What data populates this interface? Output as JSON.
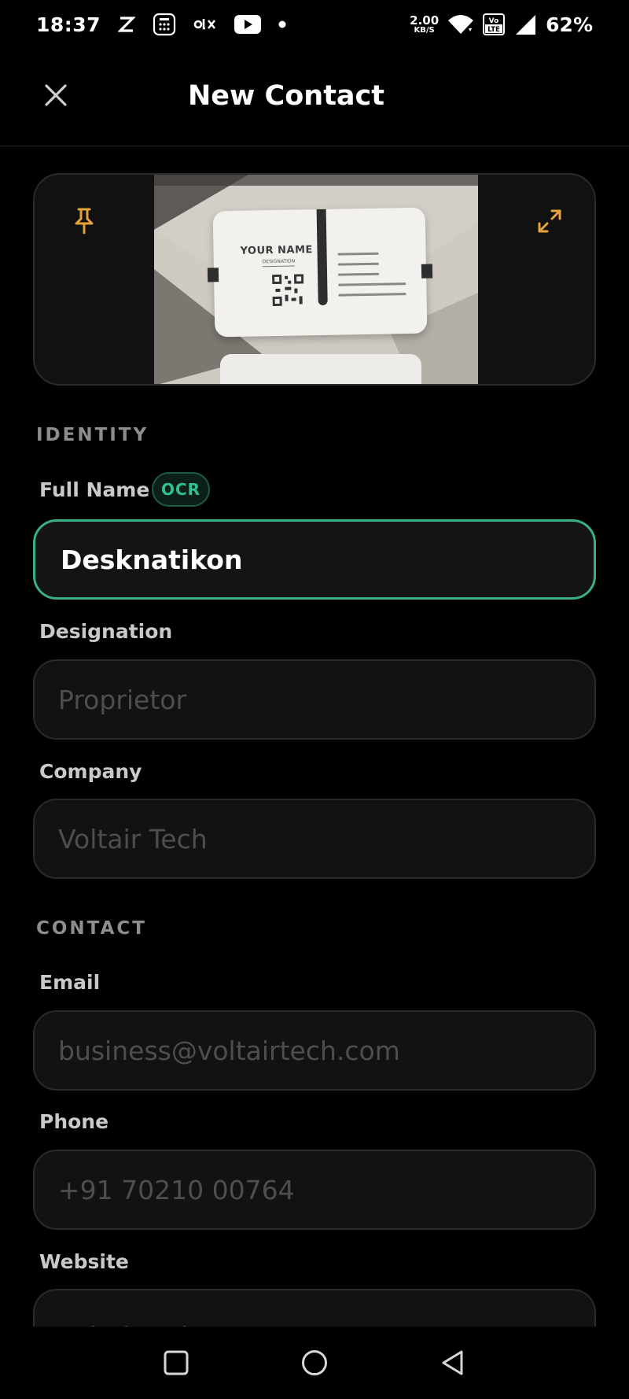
{
  "status_bar": {
    "time": "18:37",
    "network_speed_value": "2.00",
    "network_speed_unit": "KB/S",
    "battery": "62%",
    "icons": [
      "z-app-icon",
      "calculator-icon",
      "olx-icon",
      "youtube-icon",
      "dot-icon",
      "wifi-icon",
      "volte-icon",
      "signal-icon"
    ]
  },
  "header": {
    "title": "New Contact",
    "close_icon": "close-icon"
  },
  "card_preview": {
    "pin_icon": "pin-icon",
    "expand_icon": "expand-icon",
    "card_name_text": "YOUR NAME",
    "card_designation_text": "DESIGNATION",
    "accent_color": "#e8a23a"
  },
  "sections": {
    "identity": "IDENTITY",
    "contact": "CONTACT"
  },
  "fields": {
    "full_name": {
      "label": "Full Name",
      "badge": "OCR",
      "value": "Desknatikon"
    },
    "designation": {
      "label": "Designation",
      "placeholder": "Proprietor"
    },
    "company": {
      "label": "Company",
      "placeholder": "Voltair Tech"
    },
    "email": {
      "label": "Email",
      "placeholder": "business@voltairtech.com"
    },
    "phone": {
      "label": "Phone",
      "placeholder": "+91 70210 00764"
    },
    "website": {
      "label": "Website",
      "placeholder": "voltairtech.com"
    }
  },
  "colors": {
    "focus_border": "#3aaf86",
    "ocr_badge": "#30c28d",
    "background": "#000000",
    "input_bg": "#121212"
  },
  "nav_bar": {
    "icons": [
      "recents-square-icon",
      "home-circle-icon",
      "back-triangle-icon"
    ]
  }
}
